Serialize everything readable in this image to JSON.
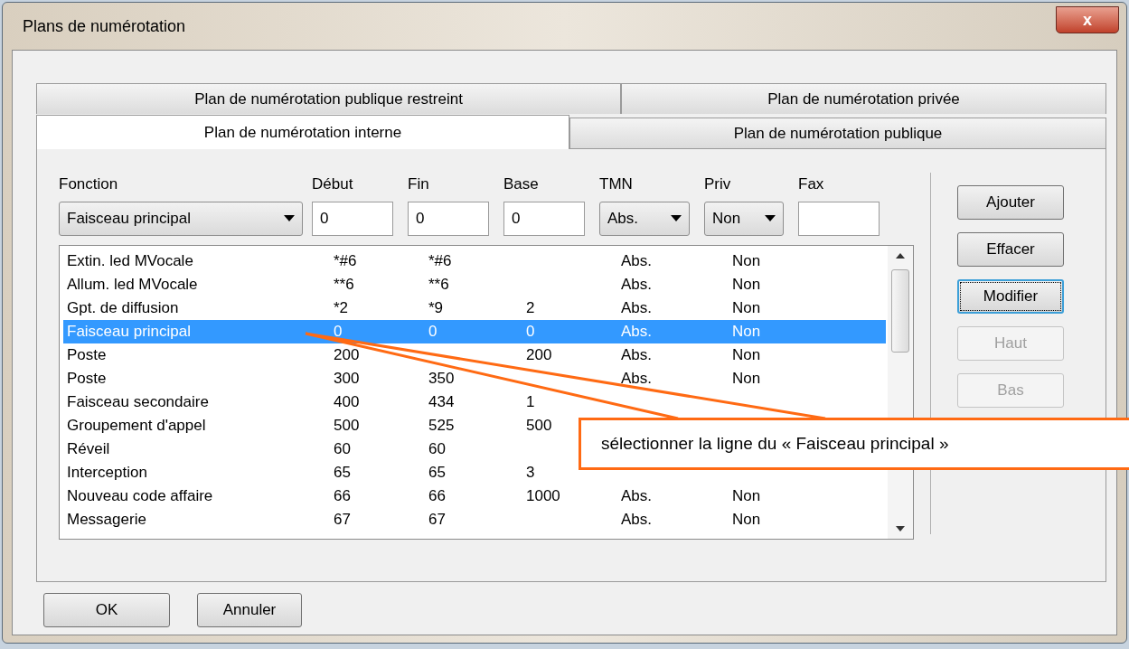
{
  "window": {
    "title": "Plans de numérotation",
    "close": "x"
  },
  "tabs_back": [
    {
      "label": "Plan de numérotation publique restreint",
      "selected": false
    },
    {
      "label": "Plan de numérotation privée",
      "selected": false
    }
  ],
  "tabs_front": [
    {
      "label": "Plan de numérotation interne",
      "selected": true
    },
    {
      "label": "Plan de numérotation publique",
      "selected": false
    }
  ],
  "form": {
    "fonction": {
      "label": "Fonction",
      "value": "Faisceau principal"
    },
    "debut": {
      "label": "Début",
      "value": "0"
    },
    "fin": {
      "label": "Fin",
      "value": "0"
    },
    "base": {
      "label": "Base",
      "value": "0"
    },
    "tmn": {
      "label": "TMN",
      "value": "Abs."
    },
    "priv": {
      "label": "Priv",
      "value": "Non"
    },
    "fax": {
      "label": "Fax"
    }
  },
  "list": [
    {
      "fonction": "Extin. led MVocale",
      "debut": "*#6",
      "fin": "*#6",
      "tmn": "Abs.",
      "priv": "Non",
      "selected": false
    },
    {
      "fonction": "Allum. led MVocale",
      "debut": "**6",
      "fin": "**6",
      "tmn": "Abs.",
      "priv": "Non",
      "selected": false
    },
    {
      "fonction": "Gpt. de diffusion",
      "debut": "*2",
      "fin": "*9",
      "base": "2",
      "tmn": "Abs.",
      "priv": "Non",
      "selected": false
    },
    {
      "fonction": "Faisceau principal",
      "debut": "0",
      "fin": "0",
      "base": "0",
      "tmn": "Abs.",
      "priv": "Non",
      "selected": true
    },
    {
      "fonction": "Poste",
      "debut": "200",
      "base": "200",
      "tmn": "Abs.",
      "priv": "Non",
      "selected": false
    },
    {
      "fonction": "Poste",
      "debut": "300",
      "fin": "350",
      "tmn": "Abs.",
      "priv": "Non",
      "selected": false
    },
    {
      "fonction": "Faisceau secondaire",
      "debut": "400",
      "fin": "434",
      "base": "1",
      "selected": false
    },
    {
      "fonction": "Groupement d'appel",
      "debut": "500",
      "fin": "525",
      "base": "500",
      "selected": false
    },
    {
      "fonction": "Réveil",
      "debut": "60",
      "fin": "60",
      "selected": false
    },
    {
      "fonction": "Interception",
      "debut": "65",
      "fin": "65",
      "base": "3",
      "selected": false
    },
    {
      "fonction": "Nouveau code affaire",
      "debut": "66",
      "fin": "66",
      "base": "1000",
      "tmn": "Abs.",
      "priv": "Non",
      "selected": false
    },
    {
      "fonction": "Messagerie",
      "debut": "67",
      "fin": "67",
      "tmn": "Abs.",
      "priv": "Non",
      "selected": false
    }
  ],
  "side_buttons": [
    {
      "label": "Ajouter",
      "disabled": false,
      "focused": false
    },
    {
      "label": "Effacer",
      "disabled": false,
      "focused": false
    },
    {
      "label": "Modifier",
      "disabled": false,
      "focused": true
    },
    {
      "label": "Haut",
      "disabled": true,
      "focused": false
    },
    {
      "label": "Bas",
      "disabled": true,
      "focused": false
    }
  ],
  "buttons": [
    "OK",
    "Annuler"
  ],
  "callout": {
    "text": "sélectionner la ligne du « Faisceau principal »"
  }
}
